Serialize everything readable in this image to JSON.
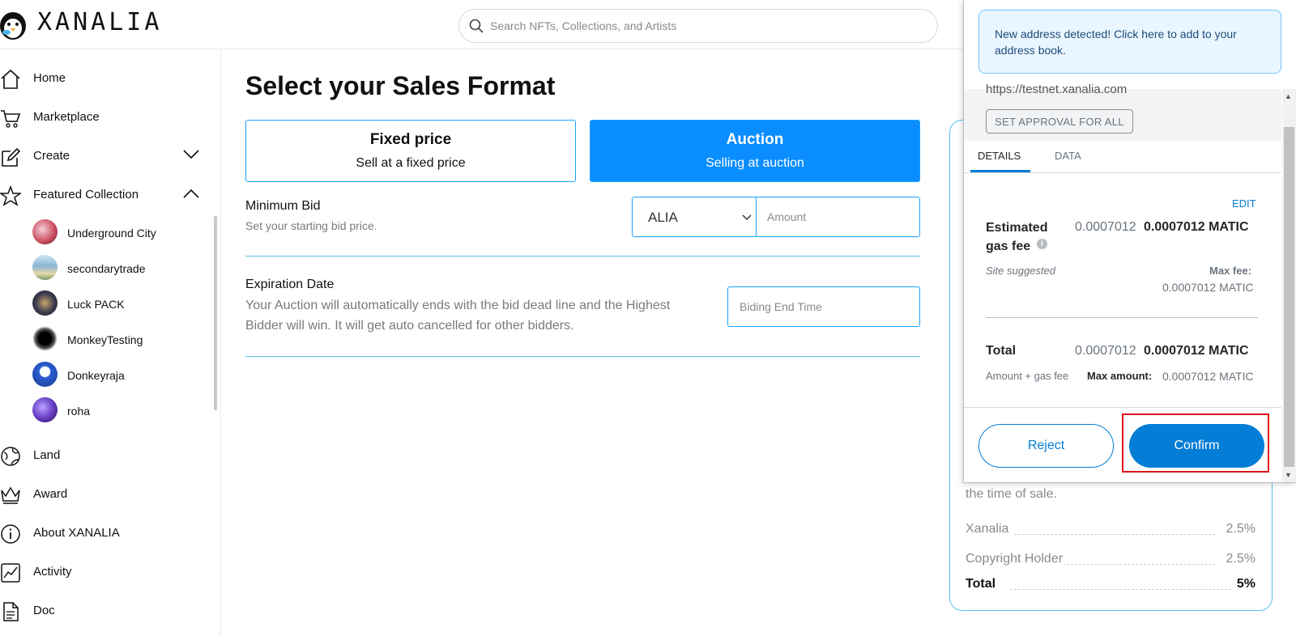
{
  "header": {
    "logo_text": "XANALIA",
    "search_placeholder": "Search NFTs, Collections, and Artists"
  },
  "sidebar": {
    "nav_top": [
      {
        "label": "Home",
        "icon": "home-icon"
      },
      {
        "label": "Marketplace",
        "icon": "cart-icon"
      },
      {
        "label": "Create",
        "icon": "edit-icon"
      },
      {
        "label": "Featured Collection",
        "icon": "star-icon"
      }
    ],
    "collections": [
      {
        "label": "Underground City",
        "color": "#c9485b"
      },
      {
        "label": "secondarytrade",
        "color": "#8ab6d6"
      },
      {
        "label": "Luck PACK",
        "color": "#3b3b4f"
      },
      {
        "label": "MonkeyTesting",
        "color": "#111111"
      },
      {
        "label": "Donkeyraja",
        "color": "#2c5fd4"
      },
      {
        "label": "roha",
        "color": "#6a3fc6"
      }
    ],
    "nav_bottom": [
      {
        "label": "Land",
        "icon": "globe-icon"
      },
      {
        "label": "Award",
        "icon": "crown-icon"
      },
      {
        "label": "About XANALIA",
        "icon": "info-icon"
      },
      {
        "label": "Activity",
        "icon": "activity-icon"
      },
      {
        "label": "Doc",
        "icon": "document-icon"
      }
    ]
  },
  "main": {
    "title": "Select your Sales Format",
    "formats": [
      {
        "title": "Fixed price",
        "subtitle": "Sell at a fixed price"
      },
      {
        "title": "Auction",
        "subtitle": "Selling at auction",
        "selected": true
      }
    ],
    "minimum_bid": {
      "title": "Minimum Bid",
      "desc": "Set your starting bid price.",
      "currency": "ALIA",
      "amount_placeholder": "Amount"
    },
    "expiration": {
      "title": "Expiration Date",
      "desc": "Your Auction will automatically ends with the bid dead line and the Highest Bidder will win. It will get auto cancelled for other bidders.",
      "placeholder": "Biding End Time"
    }
  },
  "fees": {
    "note": "the time of sale.",
    "rows": [
      {
        "label": "Xanalia",
        "value": "2.5%"
      },
      {
        "label": "Copyright Holder",
        "value": "2.5%"
      }
    ],
    "total": {
      "label": "Total",
      "value": "5%"
    }
  },
  "metamask": {
    "notice": "New address detected! Click here to add to your address book.",
    "origin": "https://testnet.xanalia.com",
    "approval_label": "SET APPROVAL FOR ALL",
    "tab_details": "DETAILS",
    "tab_data": "DATA",
    "edit": "EDIT",
    "gas_label": "Estimated gas fee",
    "gas_value": "0.0007012",
    "gas_value_strong": "0.0007012 MATIC",
    "site_suggested": "Site suggested",
    "max_fee_label": "Max fee:",
    "max_fee_value": "0.0007012 MATIC",
    "total_label": "Total",
    "total_value": "0.0007012",
    "total_value_strong": "0.0007012 MATIC",
    "amount_gas": "Amount + gas fee",
    "max_amount_label": "Max amount:",
    "max_amount_value": "0.0007012 MATIC",
    "reject": "Reject",
    "confirm": "Confirm",
    "accent": "#037dd6"
  }
}
